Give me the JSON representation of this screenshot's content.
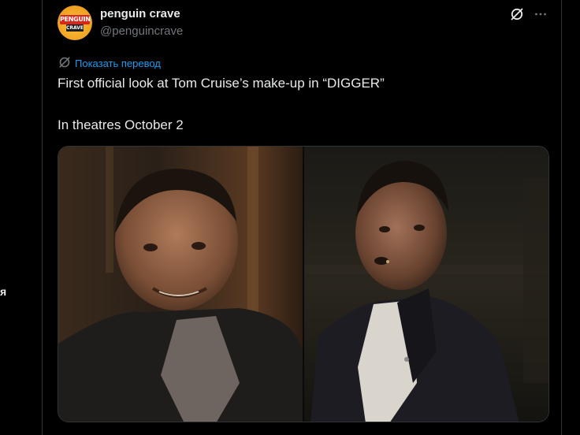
{
  "left_edge": {
    "fragment": "я"
  },
  "author": {
    "name": "penguin crave",
    "handle": "@penguincrave",
    "avatar": {
      "line1": "PENGUIN",
      "line2": "CRAVE"
    }
  },
  "icons": {
    "grok": "grok-icon",
    "more": "more-icon",
    "translate": "translate-icon"
  },
  "translate_label": "Показать перевод",
  "tweet": {
    "line1": "First official look at Tom Cruise’s make-up in “DIGGER”",
    "line2": "In theatres October 2"
  },
  "colors": {
    "accent": "#1d9bf0",
    "text": "#e7e9ea",
    "muted": "#71767b",
    "background": "#000000"
  }
}
